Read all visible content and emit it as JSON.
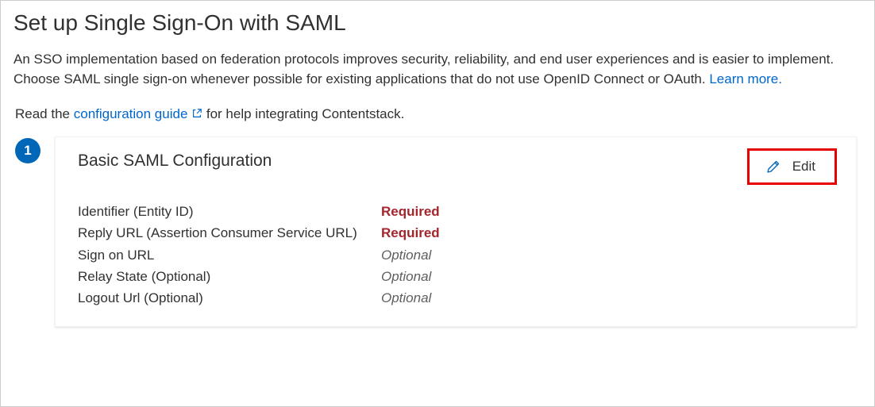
{
  "page": {
    "title": "Set up Single Sign-On with SAML",
    "intro_prefix": "An SSO implementation based on federation protocols improves security, reliability, and end user experiences and is easier to implement. Choose SAML single sign-on whenever possible for existing applications that do not use OpenID Connect or OAuth. ",
    "learn_more": "Learn more.",
    "guide_prefix": "Read the ",
    "guide_link": "configuration guide",
    "guide_suffix": " for help integrating Contentstack."
  },
  "step": {
    "number": "1",
    "title": "Basic SAML Configuration",
    "edit_label": "Edit"
  },
  "fields": {
    "identifier": {
      "label": "Identifier (Entity ID)",
      "value": "Required",
      "kind": "required"
    },
    "reply_url": {
      "label": "Reply URL (Assertion Consumer Service URL)",
      "value": "Required",
      "kind": "required"
    },
    "sign_on": {
      "label": "Sign on URL",
      "value": "Optional",
      "kind": "optional"
    },
    "relay_state": {
      "label": "Relay State (Optional)",
      "value": "Optional",
      "kind": "optional"
    },
    "logout_url": {
      "label": "Logout Url (Optional)",
      "value": "Optional",
      "kind": "optional"
    }
  }
}
